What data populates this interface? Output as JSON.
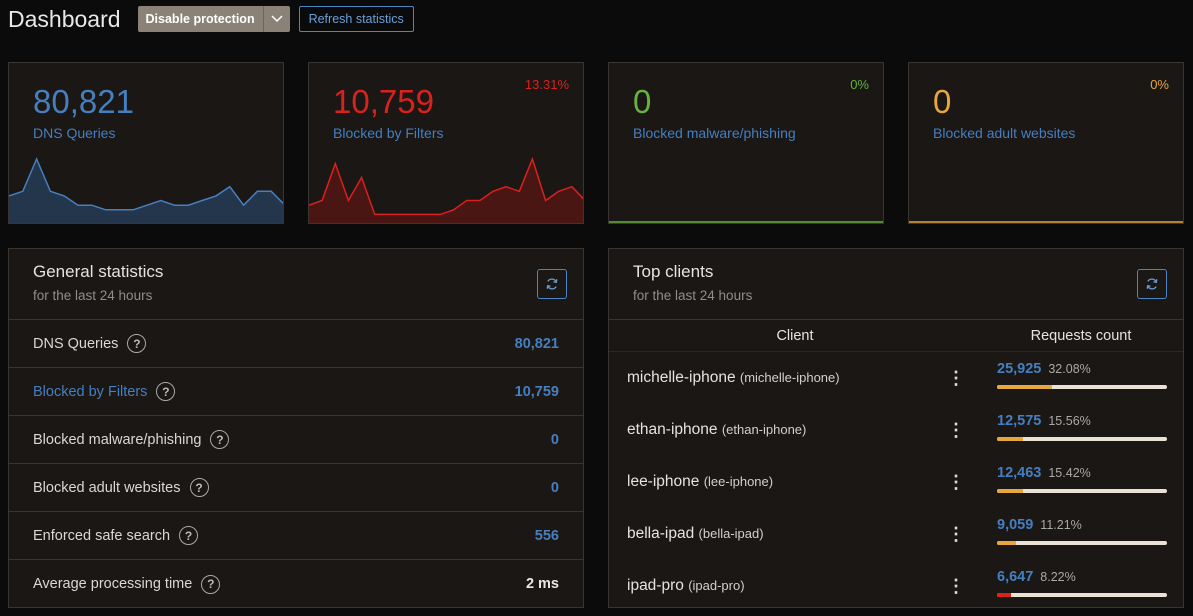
{
  "header": {
    "title": "Dashboard",
    "disable_label": "Disable protection",
    "refresh_label": "Refresh statistics"
  },
  "cards": [
    {
      "value": "80,821",
      "label": "DNS Queries",
      "percent": "",
      "color": "#467fbf",
      "fill": "#23364b",
      "series": [
        5,
        6,
        13,
        6,
        5,
        3,
        3,
        2,
        2,
        2,
        3,
        4,
        3,
        3,
        4,
        5,
        7,
        3,
        6,
        6,
        3
      ]
    },
    {
      "value": "10,759",
      "label": "Blocked by Filters",
      "percent": "13.31%",
      "color": "#d9211e",
      "fill": "#4a1614",
      "series": [
        3,
        4,
        12,
        4,
        9,
        1,
        1,
        1,
        1,
        1,
        1,
        2,
        4,
        4,
        6,
        7,
        6,
        13,
        4,
        6,
        7,
        4
      ]
    },
    {
      "value": "0",
      "label": "Blocked malware/phishing",
      "percent": "0%",
      "color": "#67b13e",
      "fill": "#1a1715",
      "series": []
    },
    {
      "value": "0",
      "label": "Blocked adult websites",
      "percent": "0%",
      "color": "#e8a73d",
      "fill": "#1a1715",
      "series": []
    }
  ],
  "general": {
    "title": "General statistics",
    "subtitle": "for the last 24 hours",
    "rows": [
      {
        "name": "DNS Queries",
        "value": "80,821"
      },
      {
        "name": "Blocked by Filters",
        "value": "10,759"
      },
      {
        "name": "Blocked malware/phishing",
        "value": "0"
      },
      {
        "name": "Blocked adult websites",
        "value": "0"
      },
      {
        "name": "Enforced safe search",
        "value": "556"
      },
      {
        "name": "Average processing time",
        "value": "2 ms"
      }
    ],
    "help_glyph": "?"
  },
  "clients": {
    "title": "Top clients",
    "subtitle": "for the last 24 hours",
    "col_client": "Client",
    "col_requests": "Requests count",
    "rows": [
      {
        "name": "michelle-iphone",
        "id": "(michelle-iphone)",
        "count": "25,925",
        "percent": "32.08%",
        "fraction": 0.3208,
        "bar_color": "#e8a73d"
      },
      {
        "name": "ethan-iphone",
        "id": "(ethan-iphone)",
        "count": "12,575",
        "percent": "15.56%",
        "fraction": 0.1556,
        "bar_color": "#e8a73d"
      },
      {
        "name": "lee-iphone",
        "id": "(lee-iphone)",
        "count": "12,463",
        "percent": "15.42%",
        "fraction": 0.1542,
        "bar_color": "#e8a73d"
      },
      {
        "name": "bella-ipad",
        "id": "(bella-ipad)",
        "count": "9,059",
        "percent": "11.21%",
        "fraction": 0.1121,
        "bar_color": "#e8a73d"
      },
      {
        "name": "ipad-pro",
        "id": "(ipad-pro)",
        "count": "6,647",
        "percent": "8.22%",
        "fraction": 0.0822,
        "bar_color": "#d9211e"
      }
    ]
  }
}
